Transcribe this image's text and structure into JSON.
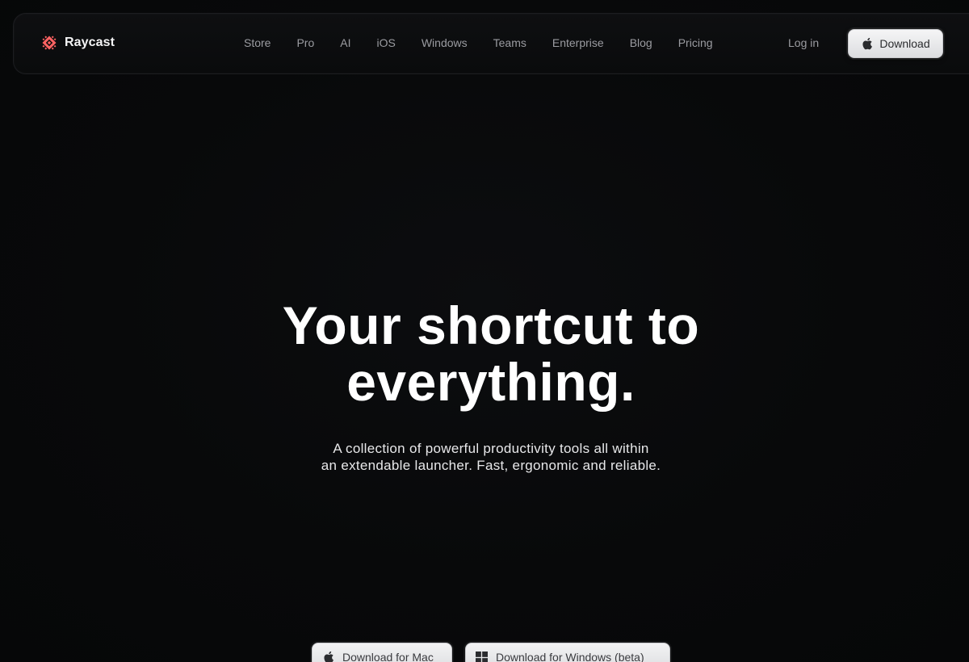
{
  "brand": {
    "name": "Raycast",
    "logo_icon": "raycast-logo-icon",
    "logo_color": "#ff6363"
  },
  "nav": {
    "links": [
      "Store",
      "Pro",
      "AI",
      "iOS",
      "Windows",
      "Teams",
      "Enterprise",
      "Blog",
      "Pricing"
    ],
    "login_label": "Log in",
    "download_label": "Download",
    "download_icon": "apple-icon"
  },
  "hero": {
    "title_line1": "Your shortcut to",
    "title_line2": "everything.",
    "subtitle_line1": "A collection of powerful productivity tools all within",
    "subtitle_line2": "an extendable launcher. Fast, ergonomic and reliable."
  },
  "cta": {
    "mac_label": "Download for Mac",
    "mac_icon": "apple-icon",
    "windows_label": "Download for Windows (beta)",
    "windows_icon": "windows-icon"
  },
  "colors": {
    "background": "#070809",
    "button_bg": "#ececee",
    "nav_text": "#9b9ca1",
    "accent": "#ff6363"
  }
}
